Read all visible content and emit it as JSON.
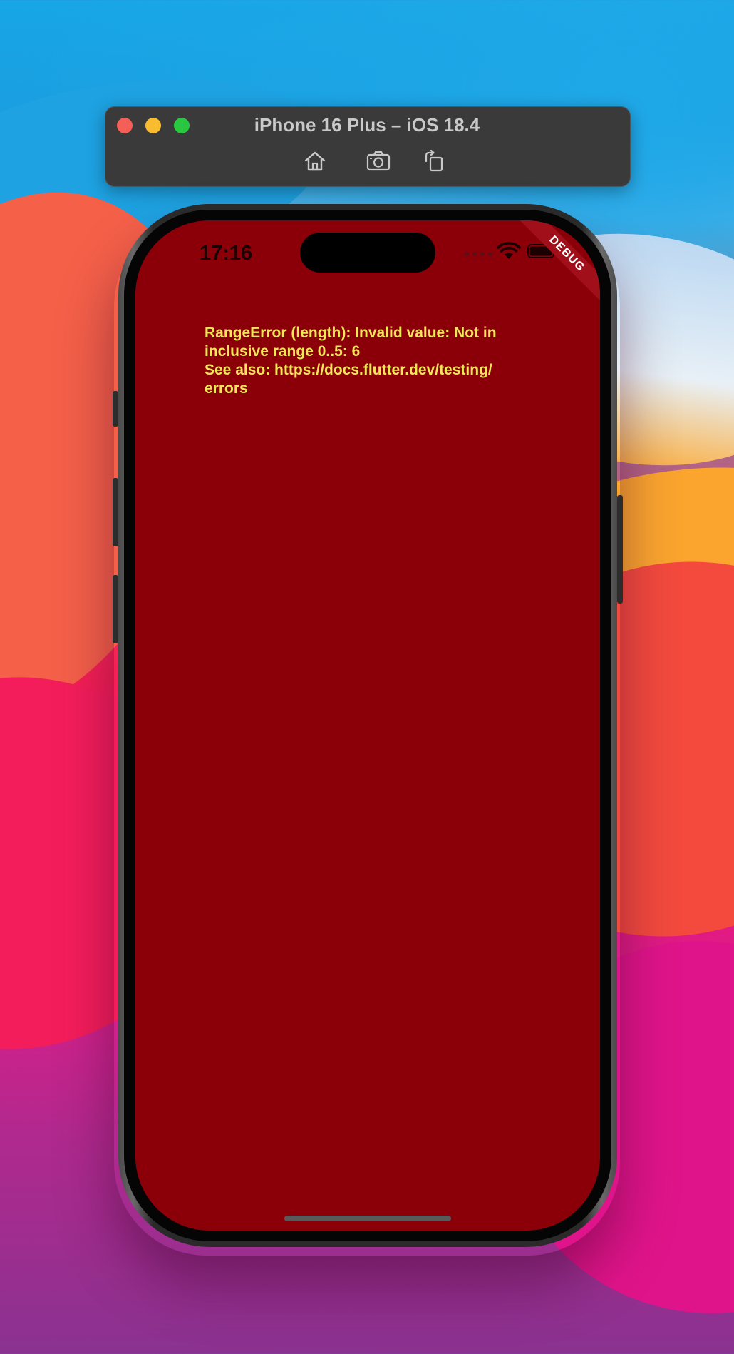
{
  "simulator": {
    "title": "iPhone 16 Plus – iOS 18.4",
    "traffic_lights": [
      {
        "name": "close",
        "color": "#f45f57"
      },
      {
        "name": "minimize",
        "color": "#f9bc2e"
      },
      {
        "name": "zoom",
        "color": "#29c840"
      }
    ],
    "toolbar": {
      "home_icon": "home-icon",
      "screenshot_icon": "camera-icon",
      "rotate_icon": "rotate-icon"
    }
  },
  "device": {
    "status_bar": {
      "time": "17:16",
      "wifi_icon": "wifi-icon",
      "battery_icon": "battery-icon"
    },
    "debug_banner": "DEBUG",
    "error_message": "RangeError (length): Invalid value: Not in\ninclusive range 0..5: 6\nSee also: https://docs.flutter.dev/testing/\nerrors",
    "colors": {
      "screen_background": "#8b0008",
      "error_text": "#f2e55a"
    }
  }
}
